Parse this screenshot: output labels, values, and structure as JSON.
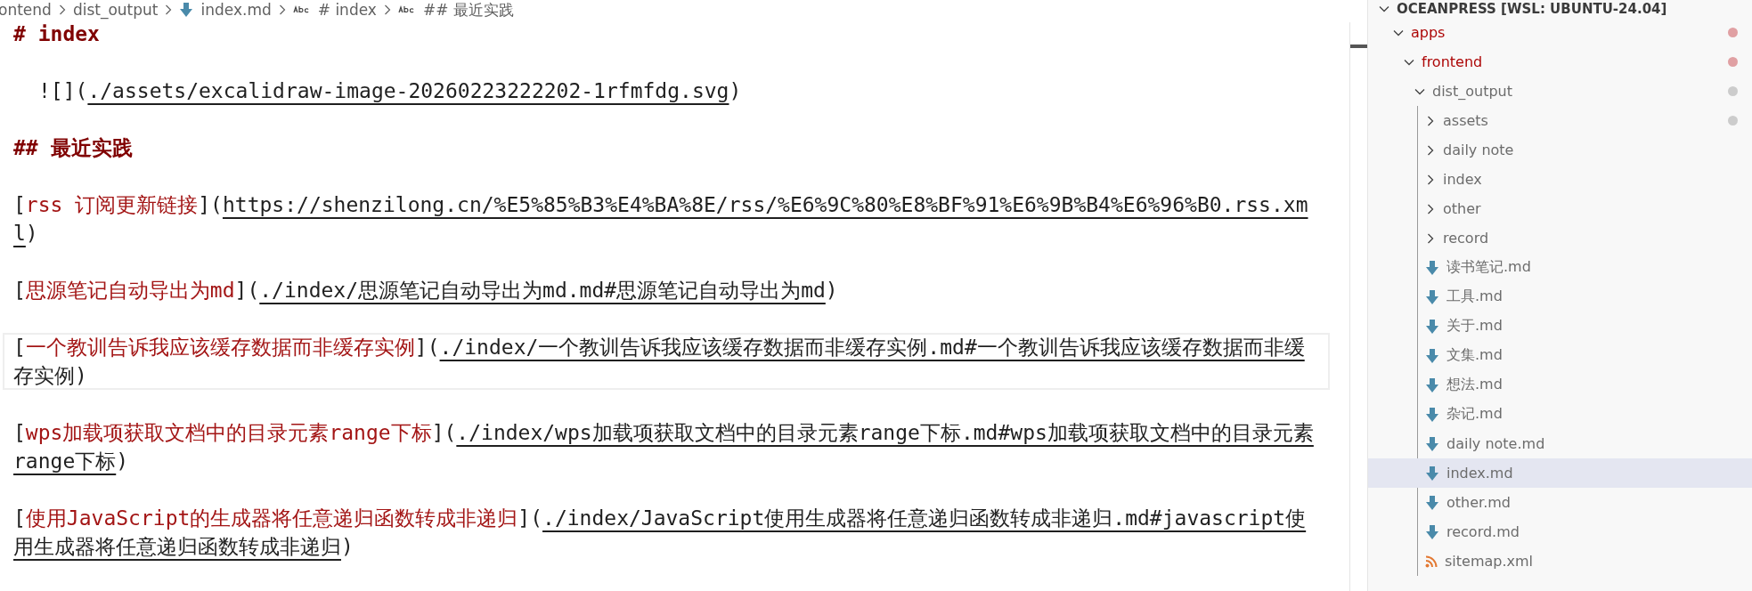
{
  "breadcrumbs": [
    {
      "kind": "folder",
      "label": "ontend"
    },
    {
      "kind": "folder",
      "label": "dist_output"
    },
    {
      "kind": "markdown",
      "label": "index.md"
    },
    {
      "kind": "symbol",
      "label": "# index"
    },
    {
      "kind": "symbol",
      "label": "## 最近实践"
    }
  ],
  "editor": {
    "lines": [
      {
        "kind": "heading",
        "current": false,
        "parts": [
          {
            "kind": "heading",
            "text": "# index"
          }
        ]
      },
      {
        "kind": "blank",
        "current": false
      },
      {
        "kind": "image",
        "current": false,
        "parts": [
          {
            "kind": "punct",
            "text": "![]("
          },
          {
            "kind": "url",
            "text": "./assets/excalidraw-image-20260223222202-1rfmfdg.svg"
          },
          {
            "kind": "punct",
            "text": ")"
          }
        ]
      },
      {
        "kind": "blank",
        "current": false
      },
      {
        "kind": "heading",
        "current": false,
        "parts": [
          {
            "kind": "heading",
            "text": "## 最近实践"
          }
        ]
      },
      {
        "kind": "blank",
        "current": false
      },
      {
        "kind": "link",
        "current": false,
        "parts": [
          {
            "kind": "punct",
            "text": "["
          },
          {
            "kind": "label",
            "text": "rss 订阅更新链接"
          },
          {
            "kind": "punct",
            "text": "]("
          },
          {
            "kind": "url",
            "text": "https://shenzilong.cn/%E5%85%B3%E4%BA%8E/rss/%E6%9C%80%E8%BF%91%E6%9B%B4%E6%96%B0.rss.xml"
          },
          {
            "kind": "punct",
            "text": ")"
          }
        ]
      },
      {
        "kind": "blank",
        "current": false
      },
      {
        "kind": "link",
        "current": false,
        "parts": [
          {
            "kind": "punct",
            "text": "["
          },
          {
            "kind": "label",
            "text": "思源笔记自动导出为md"
          },
          {
            "kind": "punct",
            "text": "]("
          },
          {
            "kind": "url",
            "text": "./index/思源笔记自动导出为md.md#思源笔记自动导出为md"
          },
          {
            "kind": "punct",
            "text": ")"
          }
        ]
      },
      {
        "kind": "blank",
        "current": false
      },
      {
        "kind": "link",
        "current": true,
        "parts": [
          {
            "kind": "punct",
            "text": "["
          },
          {
            "kind": "label",
            "text": "一个教训告诉我应该缓存数据而非缓存实例"
          },
          {
            "kind": "punct",
            "text": "]("
          },
          {
            "kind": "url",
            "text": "./index/一个教训告诉我应该缓存数据而非缓存实例.md#一个教训告诉我应该缓存数据而非缓存实例"
          },
          {
            "kind": "punct",
            "text": ")"
          }
        ]
      },
      {
        "kind": "blank",
        "current": false
      },
      {
        "kind": "link",
        "current": false,
        "parts": [
          {
            "kind": "punct",
            "text": "["
          },
          {
            "kind": "label",
            "text": "wps加载项获取文档中的目录元素range下标"
          },
          {
            "kind": "punct",
            "text": "]("
          },
          {
            "kind": "url",
            "text": "./index/wps加载项获取文档中的目录元素range下标.md#wps加载项获取文档中的目录元素range下标"
          },
          {
            "kind": "punct",
            "text": ")"
          }
        ]
      },
      {
        "kind": "blank",
        "current": false
      },
      {
        "kind": "link",
        "current": false,
        "parts": [
          {
            "kind": "punct",
            "text": "["
          },
          {
            "kind": "label",
            "text": "使用JavaScript的生成器将任意递归函数转成非递归"
          },
          {
            "kind": "punct",
            "text": "]("
          },
          {
            "kind": "url",
            "text": "./index/JavaScript使用生成器将任意递归函数转成非递归.md#javascript使用生成器将任意递归函数转成非递归"
          },
          {
            "kind": "punct",
            "text": ")"
          }
        ]
      }
    ]
  },
  "explorer": {
    "title": "OCEANPRESS [WSL: UBUNTU-24.04]",
    "expanded": true,
    "items": [
      {
        "kind": "folder",
        "label": "apps",
        "expanded": true,
        "modified": true,
        "selected": false,
        "color": "#e0a0a3",
        "children": [
          {
            "kind": "folder",
            "label": "frontend",
            "expanded": true,
            "modified": true,
            "selected": false,
            "color": "#e0a0a3",
            "children": [
              {
                "kind": "folder",
                "label": "dist_output",
                "expanded": true,
                "modified": false,
                "selected": false,
                "color": "#cccccc",
                "children": [
                  {
                    "kind": "folder",
                    "label": "assets",
                    "expanded": false,
                    "modified": false,
                    "selected": false,
                    "color": "#cccccc"
                  },
                  {
                    "kind": "folder",
                    "label": "daily note",
                    "expanded": false,
                    "modified": false,
                    "selected": false
                  },
                  {
                    "kind": "folder",
                    "label": "index",
                    "expanded": false,
                    "modified": false,
                    "selected": false
                  },
                  {
                    "kind": "folder",
                    "label": "other",
                    "expanded": false,
                    "modified": false,
                    "selected": false
                  },
                  {
                    "kind": "folder",
                    "label": "record",
                    "expanded": false,
                    "modified": false,
                    "selected": false
                  },
                  {
                    "kind": "markdown",
                    "label": "读书笔记.md",
                    "modified": false,
                    "selected": false
                  },
                  {
                    "kind": "markdown",
                    "label": "工具.md",
                    "modified": false,
                    "selected": false
                  },
                  {
                    "kind": "markdown",
                    "label": "关于.md",
                    "modified": false,
                    "selected": false
                  },
                  {
                    "kind": "markdown",
                    "label": "文集.md",
                    "modified": false,
                    "selected": false
                  },
                  {
                    "kind": "markdown",
                    "label": "想法.md",
                    "modified": false,
                    "selected": false
                  },
                  {
                    "kind": "markdown",
                    "label": "杂记.md",
                    "modified": false,
                    "selected": false
                  },
                  {
                    "kind": "markdown",
                    "label": "daily note.md",
                    "modified": false,
                    "selected": false
                  },
                  {
                    "kind": "markdown",
                    "label": "index.md",
                    "modified": false,
                    "selected": true
                  },
                  {
                    "kind": "markdown",
                    "label": "other.md",
                    "modified": false,
                    "selected": false
                  },
                  {
                    "kind": "markdown",
                    "label": "record.md",
                    "modified": false,
                    "selected": false
                  },
                  {
                    "kind": "rss",
                    "label": "sitemap.xml",
                    "modified": false,
                    "selected": false
                  }
                ]
              }
            ]
          }
        ]
      }
    ]
  }
}
